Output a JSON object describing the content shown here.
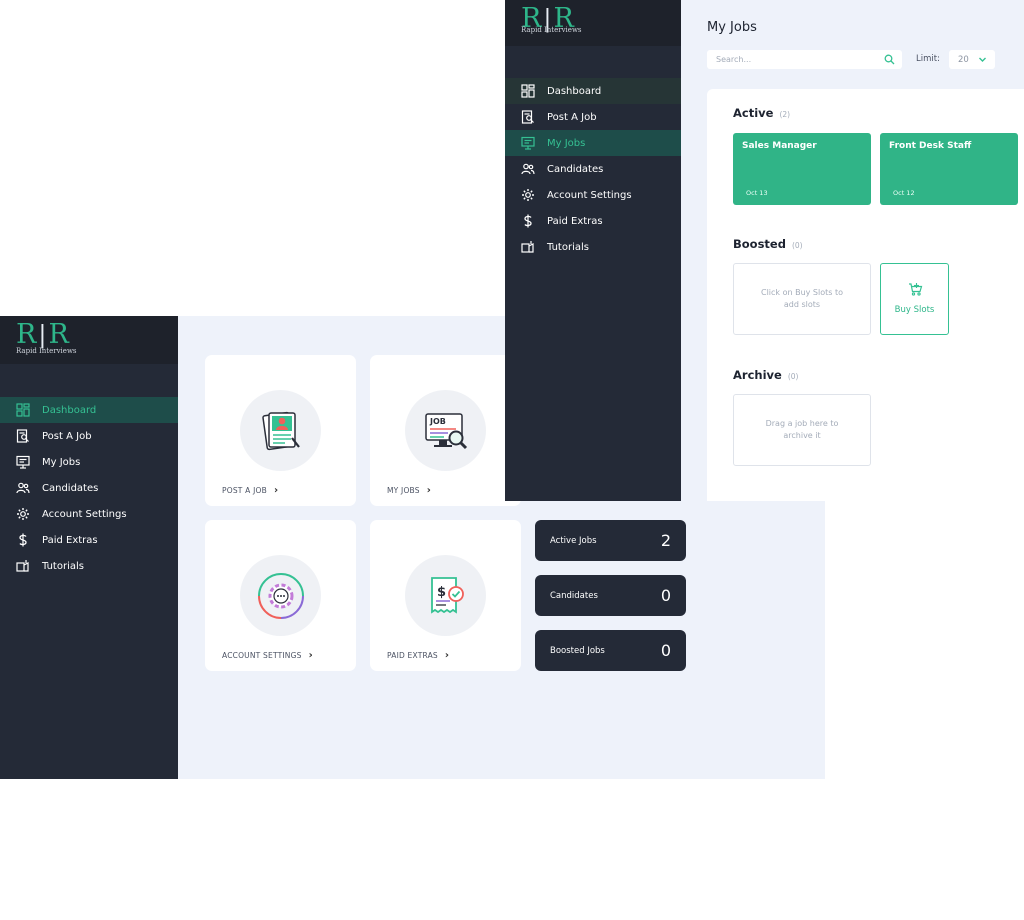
{
  "brand": {
    "logo_mark_left": "R",
    "logo_mark_right": "R",
    "logo_text": "Rapid Interviews",
    "accent": "#35c193",
    "dark": "#242a37"
  },
  "sidebar": {
    "items": [
      {
        "label": "Dashboard",
        "icon": "dashboard-icon"
      },
      {
        "label": "Post A Job",
        "icon": "post-job-icon"
      },
      {
        "label": "My Jobs",
        "icon": "my-jobs-icon"
      },
      {
        "label": "Candidates",
        "icon": "candidates-icon"
      },
      {
        "label": "Account Settings",
        "icon": "gear-icon"
      },
      {
        "label": "Paid Extras",
        "icon": "dollar-icon"
      },
      {
        "label": "Tutorials",
        "icon": "tutorials-icon"
      }
    ]
  },
  "dashboard": {
    "active_nav": "Dashboard",
    "cards": [
      {
        "label": "POST A JOB",
        "icon": "resume-icon"
      },
      {
        "label": "MY JOBS",
        "icon": "job-search-icon"
      },
      {
        "label": "ACCOUNT SETTINGS",
        "icon": "settings-gear-icon"
      },
      {
        "label": "PAID EXTRAS",
        "icon": "receipt-icon"
      }
    ],
    "stats": [
      {
        "label": "Active Jobs",
        "value": "2"
      },
      {
        "label": "Candidates",
        "value": "0"
      },
      {
        "label": "Boosted Jobs",
        "value": "0"
      }
    ]
  },
  "my_jobs": {
    "active_nav": "My Jobs",
    "title": "My Jobs",
    "search": {
      "placeholder": "Search..."
    },
    "limit": {
      "label": "Limit:",
      "value": "20"
    },
    "sections": {
      "active": {
        "title": "Active",
        "count": "(2)",
        "jobs": [
          {
            "title": "Sales Manager",
            "date": "Oct 13"
          },
          {
            "title": "Front Desk Staff",
            "date": "Oct 12"
          }
        ]
      },
      "boosted": {
        "title": "Boosted",
        "count": "(0)",
        "empty_text": "Click on Buy Slots to add slots",
        "buy_label": "Buy Slots"
      },
      "archive": {
        "title": "Archive",
        "count": "(0)",
        "empty_text": "Drag a job here to archive it"
      }
    }
  }
}
